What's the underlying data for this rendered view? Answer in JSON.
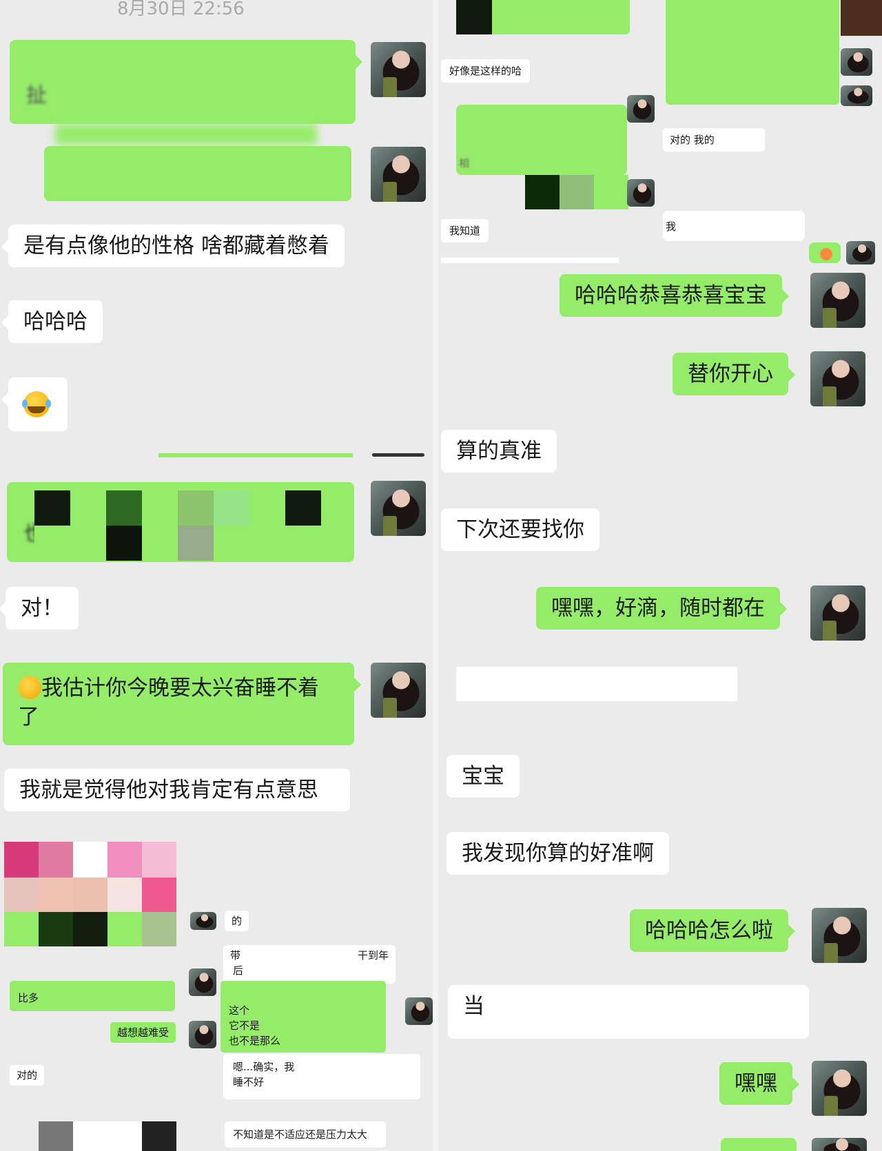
{
  "left_column": {
    "timestamp": "8月30日 22:56",
    "partial_text_1": "扯",
    "partial_text_2": "也",
    "msg_personality": "是有点像他的性格 啥都藏着憋着",
    "msg_haha": "哈哈哈",
    "msg_dui": "对！",
    "msg_excited": "我估计你今晚要太兴奋睡不着了",
    "msg_interested": "我就是觉得他对我肯定有点意思",
    "small_de": "的",
    "small_dai": "带",
    "small_gandaonian": "干到年",
    "small_hou": "后",
    "small_biduo": "比多",
    "small_zhege": "这个",
    "small_tabushi": "它不是",
    "small_yebushi": "也不是那么",
    "small_yuexiang": "越想越难受",
    "small_duide": "对的",
    "small_enquesh": "嗯...确实，我",
    "small_shuibuhao": "睡不好",
    "small_buzhidao": "不知道是不适应还是压力太大"
  },
  "right_column": {
    "small_haoxiang": "好像是这样的哈",
    "small_duide_wode": "对的 我的",
    "small_xiang": "相",
    "small_wozhidao": "我知道",
    "small_wo": "我",
    "msg_congrats": "哈哈哈恭喜恭喜宝宝",
    "msg_happy": "替你开心",
    "msg_accurate": "算的真准",
    "msg_next": "下次还要找你",
    "msg_anytime": "嘿嘿，好滴，随时都在",
    "msg_baobao": "宝宝",
    "msg_found": "我发现你算的好准啊",
    "msg_whatsup": "哈哈哈怎么啦",
    "msg_dang": "当",
    "msg_heihei": "嘿嘿"
  },
  "colors": {
    "green_bubble": "#95ec69",
    "white_bubble": "#ffffff",
    "background": "#ebebeb",
    "timestamp": "#a9a9a9"
  },
  "icons": [
    "avatar",
    "crying-laughing-emoji",
    "thinking-emoji",
    "small-emoji"
  ]
}
